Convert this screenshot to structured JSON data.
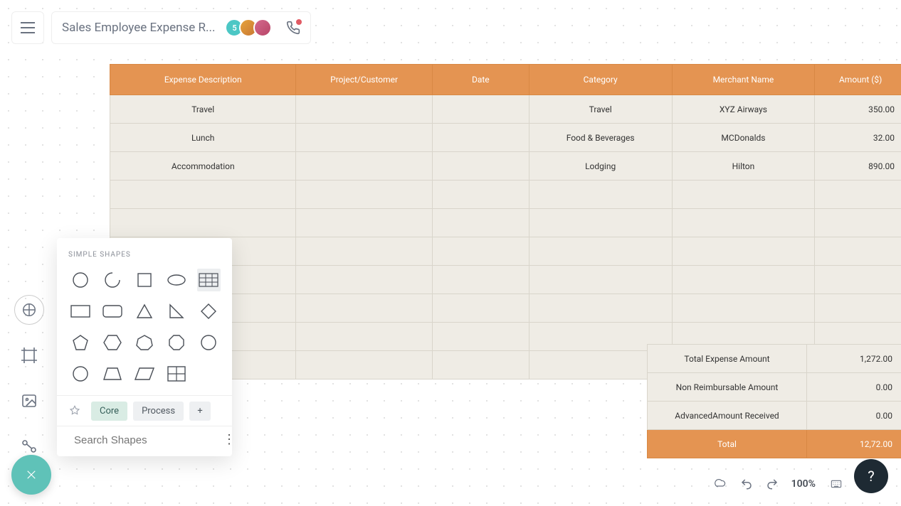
{
  "header": {
    "title": "Sales Employee Expense R...",
    "avatar_badge": "5"
  },
  "table": {
    "headers": [
      "Expense Description",
      "Project/Customer",
      "Date",
      "Category",
      "Merchant Name",
      "Amount ($)"
    ],
    "rows": [
      {
        "desc": "Travel",
        "project": "",
        "date": "",
        "category": "Travel",
        "merchant": "XYZ Airways",
        "amount": "350.00"
      },
      {
        "desc": "Lunch",
        "project": "",
        "date": "",
        "category": "Food & Beverages",
        "merchant": "MCDonalds",
        "amount": "32.00"
      },
      {
        "desc": "Accommodation",
        "project": "",
        "date": "",
        "category": "Lodging",
        "merchant": "Hilton",
        "amount": "890.00"
      }
    ],
    "empty_rows": 7
  },
  "summary": [
    {
      "label": "Total Expense  Amount",
      "value": "1,272.00"
    },
    {
      "label": "Non Reimbursable Amount",
      "value": "0.00"
    },
    {
      "label": "AdvancedAmount Received",
      "value": "0.00"
    },
    {
      "label": "Total",
      "value": "12,72.00",
      "total": true
    }
  ],
  "shapes_panel": {
    "title": "SIMPLE SHAPES",
    "tabs": {
      "core": "Core",
      "process": "Process"
    },
    "search_placeholder": "Search Shapes"
  },
  "bottom": {
    "zoom": "100%"
  },
  "help": "?"
}
